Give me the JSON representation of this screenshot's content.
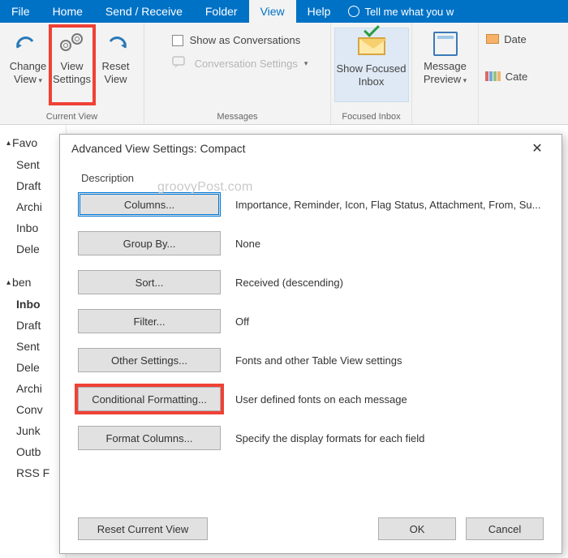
{
  "ribbon": {
    "tabs": [
      "File",
      "Home",
      "Send / Receive",
      "Folder",
      "View",
      "Help"
    ],
    "active_tab": "View",
    "tellme": "Tell me what you w",
    "groups": {
      "current_view": {
        "label": "Current View",
        "change_view": "Change View",
        "view_settings": "View Settings",
        "reset_view": "Reset View"
      },
      "messages": {
        "label": "Messages",
        "show_conversations": "Show as Conversations",
        "conversation_settings": "Conversation Settings"
      },
      "focused": {
        "label": "Focused Inbox",
        "button": "Show Focused Inbox"
      },
      "arrangement": {
        "message_preview": "Message Preview"
      },
      "edge": {
        "date": "Date",
        "cate": "Cate"
      }
    }
  },
  "nav": {
    "section1": "Favo",
    "items1": [
      "Sent",
      "Draft",
      "Archi",
      "Inbo",
      "Dele"
    ],
    "section2": "ben",
    "items2": [
      "Inbo",
      "Draft",
      "Sent",
      "Dele",
      "Archi",
      "Conv",
      "Junk",
      "Outb",
      "RSS F"
    ]
  },
  "dialog": {
    "title": "Advanced View Settings: Compact",
    "description": "Description",
    "watermark": "groovyPost.com",
    "rows": [
      {
        "btn": "Columns...",
        "val": "Importance, Reminder, Icon, Flag Status, Attachment, From, Su..."
      },
      {
        "btn": "Group By...",
        "val": "None"
      },
      {
        "btn": "Sort...",
        "val": "Received (descending)"
      },
      {
        "btn": "Filter...",
        "val": "Off"
      },
      {
        "btn": "Other Settings...",
        "val": "Fonts and other Table View settings"
      },
      {
        "btn": "Conditional Formatting...",
        "val": "User defined fonts on each message"
      },
      {
        "btn": "Format Columns...",
        "val": "Specify the display formats for each field"
      }
    ],
    "reset": "Reset Current View",
    "ok": "OK",
    "cancel": "Cancel"
  }
}
